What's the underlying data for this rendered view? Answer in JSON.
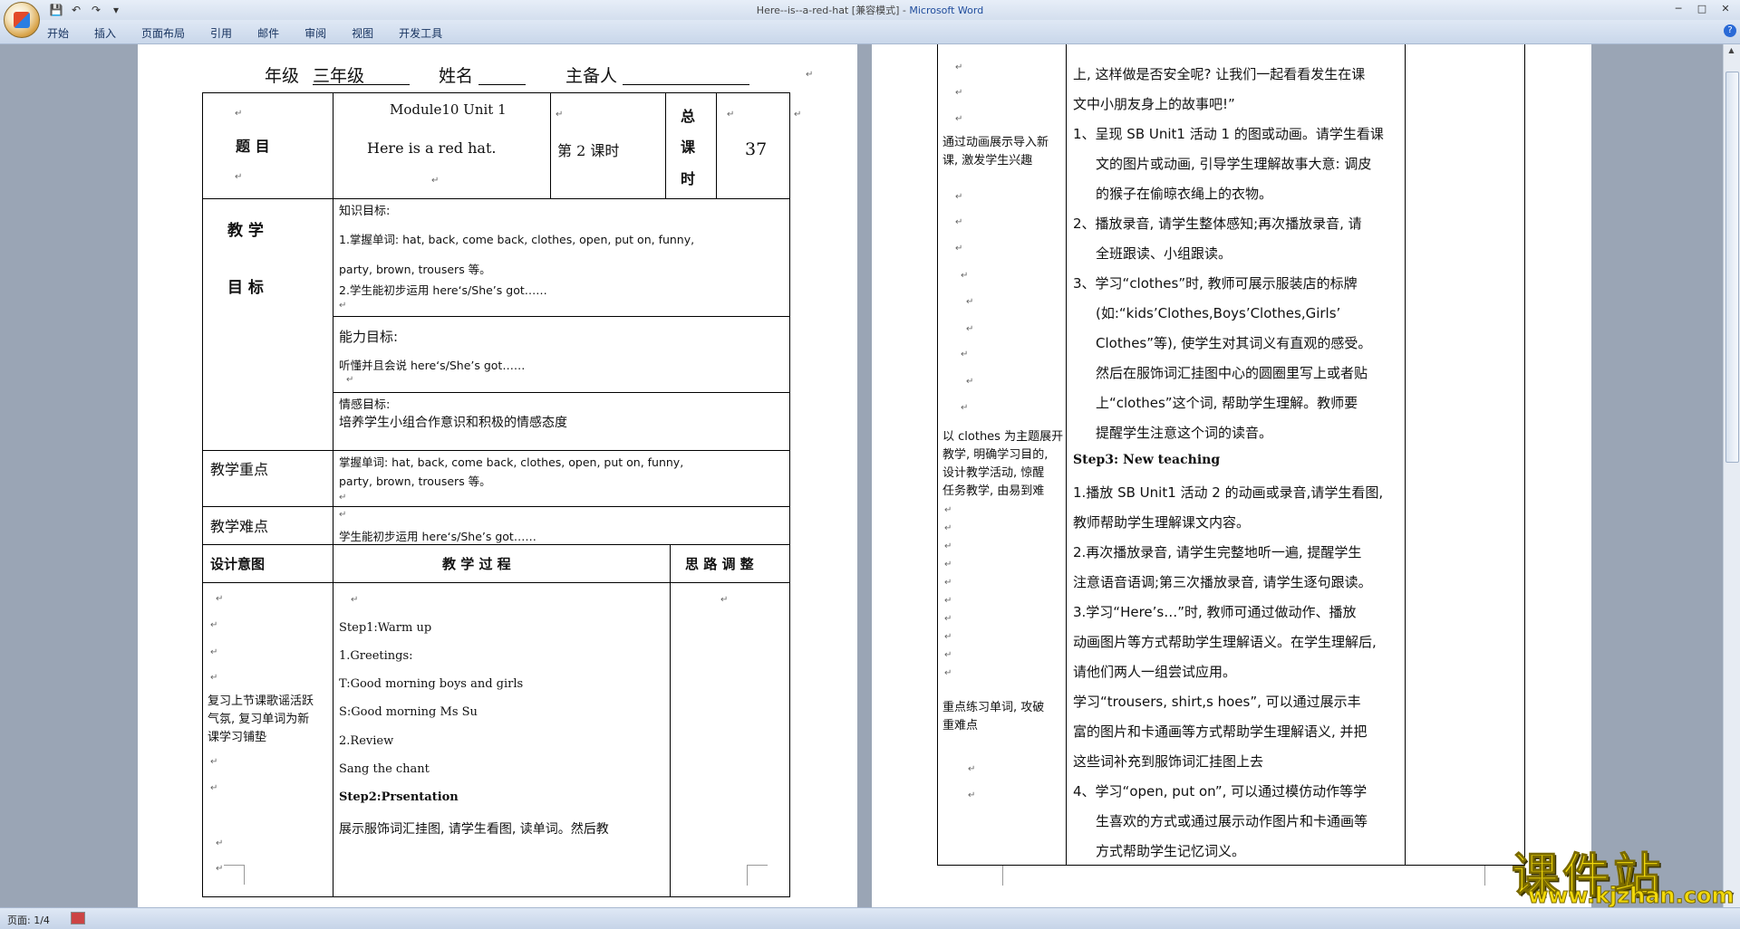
{
  "window": {
    "title_doc": "Here--is--a-red-hat [兼容模式] -",
    "title_app": "Microsoft Word",
    "minimize": "─",
    "maximize": "□",
    "close": "✕"
  },
  "quick_access": {
    "save_icon": "💾",
    "undo_icon": "↶",
    "redo_icon": "↷",
    "more_icon": "▾"
  },
  "ribbon": {
    "tabs": [
      "开始",
      "插入",
      "页面布局",
      "引用",
      "邮件",
      "审阅",
      "视图",
      "开发工具"
    ],
    "help": "?"
  },
  "status": {
    "page": "页面: 1/4"
  },
  "para_mark": "↵",
  "page1": {
    "header_grade_label": "年级",
    "header_grade_value": "三年级",
    "header_name_label": "姓名",
    "header_preparer_label": "主备人",
    "topic_label": "题 目",
    "topic_line1": "Module10 Unit 1",
    "topic_line2": "Here is a red hat.",
    "period_label": "第 2 课时",
    "total_label_1": "总",
    "total_label_2": "课",
    "total_label_3": "时",
    "total_value": "37",
    "goal_label_1": "教 学",
    "goal_label_2": "目 标",
    "knowledge_title": "知识目标:",
    "knowledge_1": "1.掌握单词: hat, back, come back, clothes, open, put on, funny,",
    "knowledge_1b": "party, brown, trousers 等。",
    "knowledge_2": "2.学生能初步运用 here‘s/She’s got……",
    "ability_title": "能力目标:",
    "ability_text": "听懂并且会说 here‘s/She’s got……",
    "emotion_title": "情感目标:",
    "emotion_text": "培养学生小组合作意识和积极的情感态度",
    "key_label": "教学重点",
    "key_1": "掌握单词: hat, back, come back, clothes, open, put on, funny,",
    "key_2": "party, brown, trousers 等。",
    "difficulty_label": "教学难点",
    "difficulty_text": "学生能初步运用 here‘s/She’s got……",
    "col_design": "设计意图",
    "col_process": "教 学 过 程",
    "col_adjust": "思 路 调 整",
    "design_note": [
      "复习上节课歌谣活跃",
      "气氛, 复习单词为新",
      "课学习铺垫"
    ],
    "process": [
      "Step1:Warm up",
      "1.Greetings:",
      "T:Good morning boys and girls",
      "S:Good morning Ms Su",
      "2.Review",
      "Sang the chant",
      "Step2:Prsentation",
      "展示服饰词汇挂图, 请学生看图, 读单词。然后教"
    ]
  },
  "page2": {
    "left_notes": {
      "n1": [
        "通过动画展示导入新",
        "课, 激发学生兴趣"
      ],
      "n2": [
        "以 clothes 为主题展开",
        "教学, 明确学习目的,",
        "设计教学活动, 惊醒",
        "任务教学, 由易到难"
      ],
      "n3": [
        "重点练习单词, 攻破",
        "重难点"
      ]
    },
    "lines": [
      "上, 这样做是否安全呢? 让我们一起看看发生在课",
      "文中小朋友身上的故事吧!”",
      "1、呈现 SB Unit1 活动 1 的图或动画。请学生看课",
      "文的图片或动画, 引导学生理解故事大意: 调皮",
      "的猴子在偷晾衣绳上的衣物。",
      "2、播放录音, 请学生整体感知;再次播放录音, 请",
      "全班跟读、小组跟读。",
      "3、学习“clothes”时, 教师可展示服装店的标牌",
      "(如:“kids’Clothes,Boys’Clothes,Girls’",
      "Clothes”等), 使学生对其词义有直观的感受。",
      "然后在服饰词汇挂图中心的圆圈里写上或者贴",
      "上“clothes”这个词, 帮助学生理解。教师要",
      "提醒学生注意这个词的读音。",
      "Step3: New teaching",
      "1.播放 SB Unit1 活动 2 的动画或录音,请学生看图,",
      "教师帮助学生理解课文内容。",
      "2.再次播放录音, 请学生完整地听一遍, 提醒学生",
      "注意语音语调;第三次播放录音, 请学生逐句跟读。",
      "3.学习“Here’s…”时, 教师可通过做动作、播放",
      "动画图片等方式帮助学生理解语义。在学生理解后,",
      "请他们两人一组尝试应用。",
      "学习“trousers, shirt,s hoes”, 可以通过展示丰",
      "富的图片和卡通画等方式帮助学生理解语义, 并把",
      "这些词补充到服饰词汇挂图上去",
      "4、学习“open, put on”, 可以通过模仿动作等学",
      "生喜欢的方式或通过展示动作图片和卡通画等",
      "方式帮助学生记忆词义。"
    ]
  },
  "watermark": {
    "text": "课件站",
    "url": "www.kjzhan.com"
  }
}
